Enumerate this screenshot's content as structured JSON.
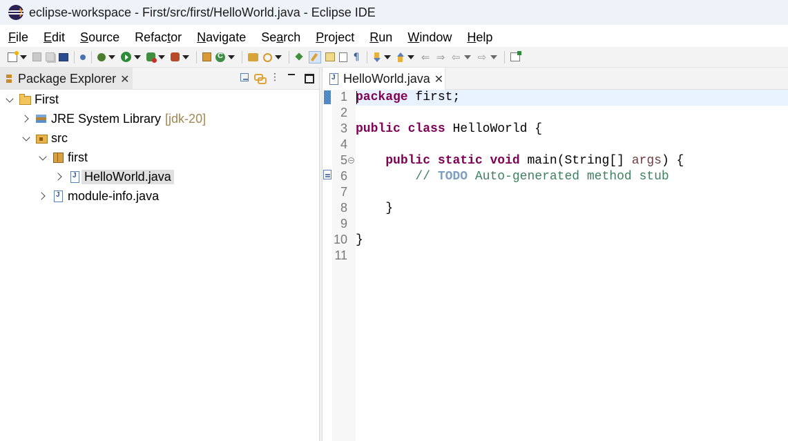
{
  "window": {
    "title": "eclipse-workspace - First/src/first/HelloWorld.java - Eclipse IDE"
  },
  "menu": [
    {
      "mnemonic": "F",
      "rest": "ile"
    },
    {
      "mnemonic": "E",
      "rest": "dit"
    },
    {
      "mnemonic": "S",
      "rest": "ource"
    },
    {
      "pre": "Refac",
      "mnemonic": "t",
      "rest": "or"
    },
    {
      "mnemonic": "N",
      "rest": "avigate"
    },
    {
      "pre": "Se",
      "mnemonic": "a",
      "rest": "rch"
    },
    {
      "mnemonic": "P",
      "rest": "roject"
    },
    {
      "mnemonic": "R",
      "rest": "un"
    },
    {
      "mnemonic": "W",
      "rest": "indow"
    },
    {
      "mnemonic": "H",
      "rest": "elp"
    }
  ],
  "package_explorer": {
    "tab_label": "Package Explorer",
    "tree": {
      "project": "First",
      "jre": "JRE System Library",
      "jre_decoration": "[jdk-20]",
      "src": "src",
      "package": "first",
      "file_selected": "HelloWorld.java",
      "module_file": "module-info.java"
    }
  },
  "editor": {
    "tab_label": "HelloWorld.java",
    "line_numbers": [
      "1",
      "2",
      "3",
      "4",
      "5",
      "6",
      "7",
      "8",
      "9",
      "10",
      "11"
    ],
    "code": {
      "l1_kw": "package",
      "l1_rest": " first;",
      "l3_kw1": "public",
      "l3_kw2": "class",
      "l3_rest": " HelloWorld {",
      "l5_indent": "    ",
      "l5_kw1": "public",
      "l5_kw2": "static",
      "l5_kw3": "void",
      "l5_mid": " main(String[] ",
      "l5_param": "args",
      "l5_end": ") {",
      "l6_indent": "        ",
      "l6_slash": "// ",
      "l6_todo": "TODO",
      "l6_rest": " Auto-generated method stub",
      "l8": "    }",
      "l10": "}"
    }
  }
}
